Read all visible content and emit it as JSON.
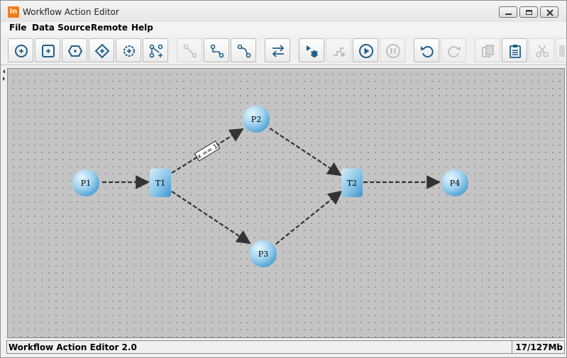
{
  "window": {
    "title": "Workflow Action Editor",
    "app_icon_text": "in"
  },
  "menu": {
    "items": [
      {
        "label": "File"
      },
      {
        "label": "Data Source"
      },
      {
        "label": "Remote"
      },
      {
        "label": "Help"
      }
    ]
  },
  "toolbar": {
    "buttons": [
      {
        "icon": "add-place-icon",
        "enabled": true
      },
      {
        "icon": "add-transition-icon",
        "enabled": true
      },
      {
        "icon": "add-hexagon-icon",
        "enabled": true
      },
      {
        "icon": "add-diamond-icon",
        "enabled": true
      },
      {
        "icon": "add-gear-icon",
        "enabled": true
      },
      {
        "icon": "add-branch-icon",
        "enabled": true
      },
      {
        "icon": "connect-icon",
        "enabled": false
      },
      {
        "icon": "connect-step-icon",
        "enabled": true
      },
      {
        "icon": "connect-curve-icon",
        "enabled": true
      },
      {
        "icon": "swap-arrows-icon",
        "enabled": true
      },
      {
        "icon": "debug-run-icon",
        "enabled": true
      },
      {
        "icon": "step-icon",
        "enabled": false
      },
      {
        "icon": "play-icon",
        "enabled": true
      },
      {
        "icon": "pause-icon",
        "enabled": false
      },
      {
        "icon": "undo-icon",
        "enabled": true
      },
      {
        "icon": "redo-icon",
        "enabled": false
      },
      {
        "icon": "copy-icon",
        "enabled": false
      },
      {
        "icon": "paste-icon",
        "enabled": true
      },
      {
        "icon": "cut-icon",
        "enabled": false
      },
      {
        "icon": "delete-icon",
        "enabled": false
      }
    ]
  },
  "graph": {
    "places": [
      {
        "id": "P1",
        "label": "P1"
      },
      {
        "id": "P2",
        "label": "P2"
      },
      {
        "id": "P3",
        "label": "P3"
      },
      {
        "id": "P4",
        "label": "P4"
      }
    ],
    "transitions": [
      {
        "id": "T1",
        "label": "T1"
      },
      {
        "id": "T2",
        "label": "T2"
      }
    ],
    "arcs": [
      {
        "from": "P1",
        "to": "T1",
        "label": ""
      },
      {
        "from": "T1",
        "to": "P2",
        "label": "x == 1"
      },
      {
        "from": "T1",
        "to": "P3",
        "label": ""
      },
      {
        "from": "P2",
        "to": "T2",
        "label": ""
      },
      {
        "from": "P3",
        "to": "T2",
        "label": ""
      },
      {
        "from": "T2",
        "to": "P4",
        "label": ""
      }
    ]
  },
  "status": {
    "left": "Workflow Action Editor 2.0",
    "memory": "17/127Mb"
  },
  "colors": {
    "node_fill_light": "#d9f0fb",
    "node_fill_dark": "#5aa9d6",
    "arc_color": "#333333",
    "canvas_bg": "#c4c4c4"
  }
}
